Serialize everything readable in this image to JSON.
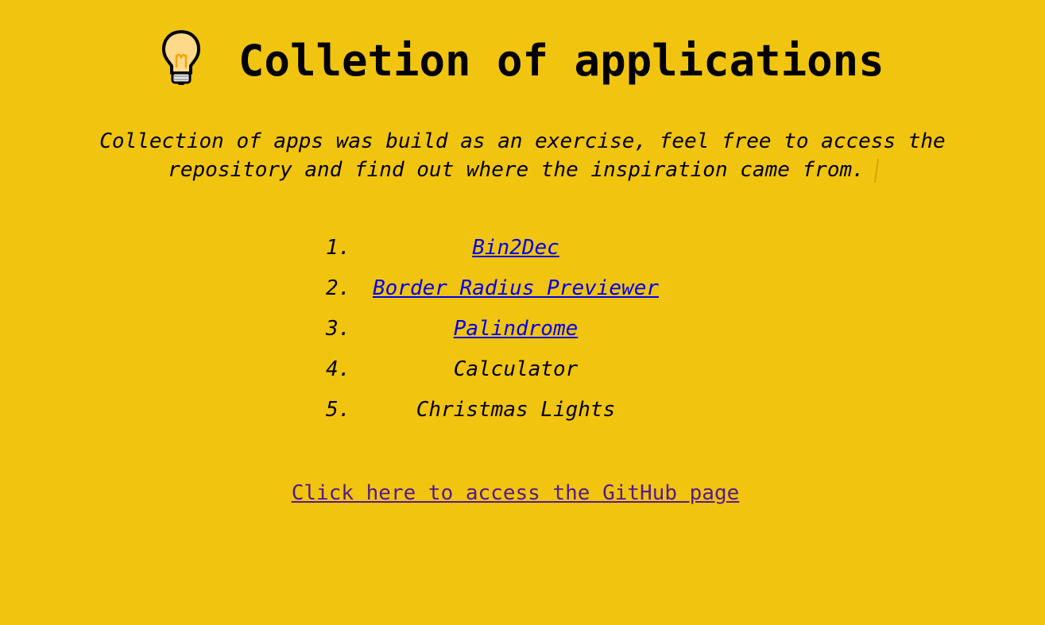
{
  "page": {
    "background_color": "#f1c40f"
  },
  "header": {
    "icon": "lightbulb-icon",
    "title": "Colletion of applications"
  },
  "subtitle": {
    "text": "Collection of apps was build as an exercise, feel free to access the repository and find out where the inspiration came from."
  },
  "apps": [
    {
      "number": "1.",
      "label": "Bin2Dec",
      "is_link": true
    },
    {
      "number": "2.",
      "label": "Border Radius Previewer",
      "is_link": true
    },
    {
      "number": "3.",
      "label": "Palindrome",
      "is_link": true
    },
    {
      "number": "4.",
      "label": "Calculator",
      "is_link": false
    },
    {
      "number": "5.",
      "label": "Christmas Lights",
      "is_link": false
    }
  ],
  "footer": {
    "github_link_label": "Click here to access the GitHub page",
    "link_color_visited": "#551a8b",
    "link_color": "#0000ee"
  }
}
